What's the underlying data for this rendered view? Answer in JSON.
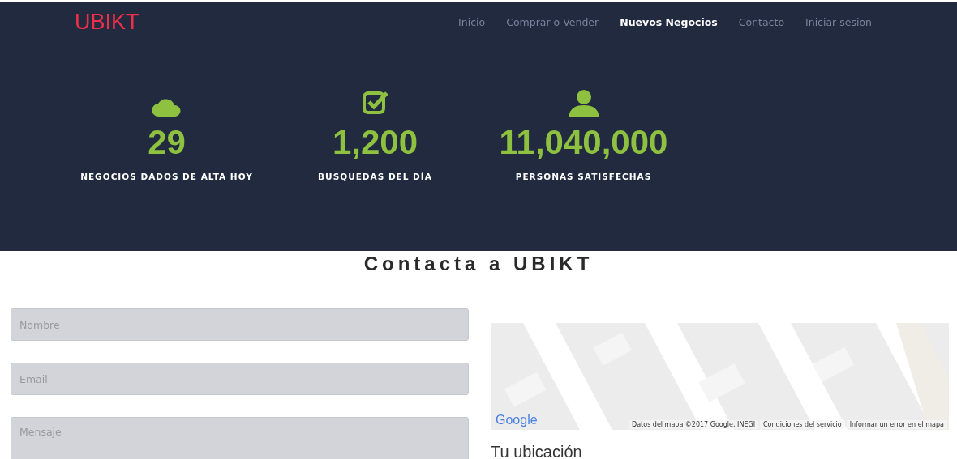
{
  "brand": "UBIKT",
  "nav": [
    {
      "label": "Inicio",
      "selected": false
    },
    {
      "label": "Comprar o Vender",
      "selected": false
    },
    {
      "label": "Nuevos Negocios",
      "selected": true
    },
    {
      "label": "Contacto",
      "selected": false
    },
    {
      "label": "Iniciar sesion",
      "selected": false
    }
  ],
  "stats": [
    {
      "kind": "cloud",
      "value": "29",
      "label": "NEGOCIOS DADOS DE ALTA HOY"
    },
    {
      "kind": "check",
      "value": "1,200",
      "label": "BUSQUEDAS DEL DÍA"
    },
    {
      "kind": "user",
      "value": "11,040,000",
      "label": "PERSONAS SATISFECHAS"
    }
  ],
  "contact": {
    "title": "Contacta a UBIKT",
    "fields": [
      {
        "placeholder": "Nombre",
        "kind": "input"
      },
      {
        "placeholder": "Email",
        "kind": "input"
      },
      {
        "placeholder": "Mensaje",
        "kind": "textarea"
      }
    ],
    "map": {
      "logo": "Google",
      "attribution": [
        "Datos del mapa ©2017 Google, INEGI",
        "Condiciones del servicio",
        "Informar un error en el mapa"
      ]
    },
    "location_heading": "Tu ubicación"
  }
}
